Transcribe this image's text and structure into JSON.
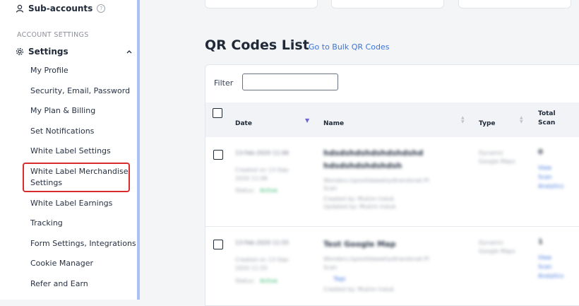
{
  "sidebar": {
    "sub_accounts": "Sub-accounts",
    "section_label": "ACCOUNT SETTINGS",
    "settings_label": "Settings",
    "items": [
      {
        "label": "My Profile"
      },
      {
        "label": "Security, Email, Password"
      },
      {
        "label": "My Plan & Billing"
      },
      {
        "label": "Set Notifications"
      },
      {
        "label": "White Label Settings"
      },
      {
        "label": "White Label Merchandise Settings"
      },
      {
        "label": "White Label Earnings"
      },
      {
        "label": "Tracking"
      },
      {
        "label": "Form Settings, Integrations"
      },
      {
        "label": "Cookie Manager"
      },
      {
        "label": "Refer and Earn"
      }
    ]
  },
  "main": {
    "title": "QR Codes List",
    "bulk_link": "Go to Bulk QR Codes",
    "filter_label": "Filter",
    "filter_value": "",
    "columns": {
      "date": "Date",
      "name": "Name",
      "type": "Type",
      "total_scan": "Total Scan"
    },
    "rows": [
      {
        "date": "13-Feb-2020 11:06",
        "meta1": "Created on 13-Sep-",
        "meta2": "2020 11:06",
        "status_label": "Status:",
        "status": "Active",
        "name": "hdsdshdshdshdshdshd",
        "name2": "hdsdshdshdshdsh",
        "desc1": "Wonders.lspoolldweeklydtrandsnet.PI",
        "desc2": "Scan",
        "desc3": "Created by: Mukim Iraluk",
        "desc4": "Updated by: Mukim Iraluk",
        "type": "Dynamic",
        "type2": "Google Maps",
        "scans": "0",
        "link1": "View",
        "link2": "Scan",
        "link3": "Analytics"
      },
      {
        "date": "13-Feb-2020 11:55",
        "meta1": "Created on 13-Sep-",
        "meta2": "2020 11:55",
        "status_label": "Status:",
        "status": "Active",
        "name": "Test Google Map",
        "desc1": "Wonders.lspoolldweeklydtrandsnet.PI",
        "desc2": "Scan",
        "desc3": "Tags",
        "desc4": "Created by: Mukim Iraluk",
        "type": "Dynamic",
        "type2": "Google Maps",
        "scans": "1",
        "link1": "View",
        "link2": "Scan",
        "link3": "Analytics"
      }
    ]
  },
  "colors": {
    "accent": "#3b73d9",
    "highlight_border": "#d92d2d",
    "sidebar_rail": "#a9c1f5",
    "sort_active": "#6f66d4"
  }
}
